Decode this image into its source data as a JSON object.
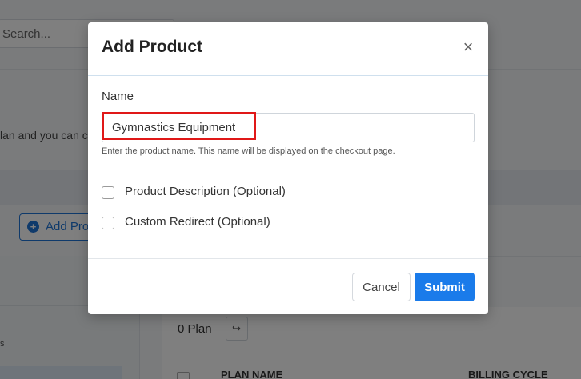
{
  "background": {
    "search_placeholder": "Search...",
    "hint_text": "lan and you can c",
    "add_button_label": "Add Pro",
    "sidebar_text": "s",
    "plan_count": "0 Plan",
    "table_headers": [
      "PLAN NAME",
      "BILLING CYCLE"
    ]
  },
  "modal": {
    "title": "Add Product",
    "close_glyph": "×",
    "name_label": "Name",
    "name_value": "Gymnastics Equipment",
    "name_help": "Enter the product name. This name will be displayed on the checkout page.",
    "options": [
      {
        "label": "Product Description (Optional)",
        "checked": false
      },
      {
        "label": "Custom Redirect (Optional)",
        "checked": false
      }
    ],
    "cancel_label": "Cancel",
    "submit_label": "Submit"
  },
  "colors": {
    "primary": "#1a7bea",
    "highlight": "#e01818"
  }
}
